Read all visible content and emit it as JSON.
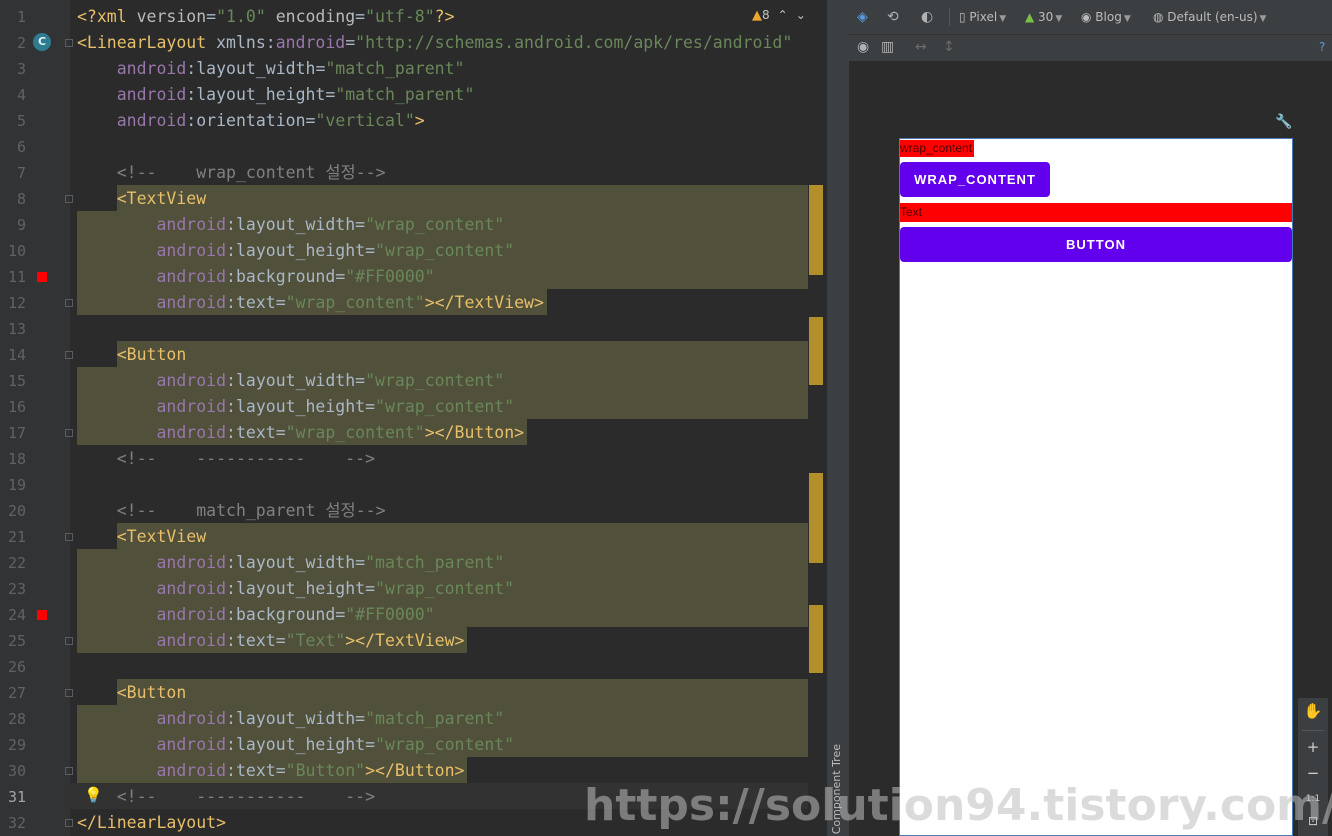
{
  "editor": {
    "line_numbers": [
      "1",
      "2",
      "3",
      "4",
      "5",
      "6",
      "7",
      "8",
      "9",
      "10",
      "11",
      "12",
      "13",
      "14",
      "15",
      "16",
      "17",
      "18",
      "19",
      "20",
      "21",
      "22",
      "23",
      "24",
      "25",
      "26",
      "27",
      "28",
      "29",
      "30",
      "31",
      "32"
    ],
    "warning_count": "8",
    "class_badge": "C",
    "lines": [
      [
        [
          "pi",
          "<?xml "
        ],
        [
          "attr2",
          "version"
        ],
        [
          "eq",
          "="
        ],
        [
          "val",
          "\"1.0\""
        ],
        [
          "attr2",
          " encoding"
        ],
        [
          "eq",
          "="
        ],
        [
          "val",
          "\"utf-8\""
        ],
        [
          "pi",
          "?>"
        ]
      ],
      [
        [
          "tag",
          "<LinearLayout "
        ],
        [
          "plain",
          "xmlns:"
        ],
        [
          "attr",
          "android"
        ],
        [
          "eq",
          "="
        ],
        [
          "val",
          "\"http://schemas.android.com/apk/res/android\""
        ]
      ],
      [
        [
          "plain",
          "    "
        ],
        [
          "attr",
          "android"
        ],
        [
          "plain",
          ":layout_width"
        ],
        [
          "eq",
          "="
        ],
        [
          "val",
          "\"match_parent\""
        ]
      ],
      [
        [
          "plain",
          "    "
        ],
        [
          "attr",
          "android"
        ],
        [
          "plain",
          ":layout_height"
        ],
        [
          "eq",
          "="
        ],
        [
          "val",
          "\"match_parent\""
        ]
      ],
      [
        [
          "plain",
          "    "
        ],
        [
          "attr",
          "android"
        ],
        [
          "plain",
          ":orientation"
        ],
        [
          "eq",
          "="
        ],
        [
          "val",
          "\"vertical\""
        ],
        [
          "tag",
          ">"
        ]
      ],
      [],
      [
        [
          "com",
          "    <!--    wrap_content 설정-->"
        ]
      ],
      [
        [
          "plain",
          "    "
        ],
        [
          "tag",
          "<TextView"
        ]
      ],
      [
        [
          "plain",
          "        "
        ],
        [
          "attr",
          "android"
        ],
        [
          "plain",
          ":layout_width"
        ],
        [
          "eq",
          "="
        ],
        [
          "val",
          "\"wrap_content\""
        ]
      ],
      [
        [
          "plain",
          "        "
        ],
        [
          "attr",
          "android"
        ],
        [
          "plain",
          ":layout_height"
        ],
        [
          "eq",
          "="
        ],
        [
          "val",
          "\"wrap_content\""
        ]
      ],
      [
        [
          "plain",
          "        "
        ],
        [
          "attr",
          "android"
        ],
        [
          "plain",
          ":background"
        ],
        [
          "eq",
          "="
        ],
        [
          "val",
          "\"#FF0000\""
        ]
      ],
      [
        [
          "plain",
          "        "
        ],
        [
          "attr",
          "android"
        ],
        [
          "plain",
          ":text"
        ],
        [
          "eq",
          "="
        ],
        [
          "val",
          "\"wrap_content\""
        ],
        [
          "tag",
          "></TextView>"
        ]
      ],
      [],
      [
        [
          "plain",
          "    "
        ],
        [
          "tag",
          "<Button"
        ]
      ],
      [
        [
          "plain",
          "        "
        ],
        [
          "attr",
          "android"
        ],
        [
          "plain",
          ":layout_width"
        ],
        [
          "eq",
          "="
        ],
        [
          "val",
          "\"wrap_content\""
        ]
      ],
      [
        [
          "plain",
          "        "
        ],
        [
          "attr",
          "android"
        ],
        [
          "plain",
          ":layout_height"
        ],
        [
          "eq",
          "="
        ],
        [
          "val",
          "\"wrap_content\""
        ]
      ],
      [
        [
          "plain",
          "        "
        ],
        [
          "attr",
          "android"
        ],
        [
          "plain",
          ":text"
        ],
        [
          "eq",
          "="
        ],
        [
          "val",
          "\"wrap_content\""
        ],
        [
          "tag",
          "></Button>"
        ]
      ],
      [
        [
          "com",
          "    <!--    -----------    -->"
        ]
      ],
      [],
      [
        [
          "com",
          "    <!--    match_parent 설정-->"
        ]
      ],
      [
        [
          "plain",
          "    "
        ],
        [
          "tag",
          "<TextView"
        ]
      ],
      [
        [
          "plain",
          "        "
        ],
        [
          "attr",
          "android"
        ],
        [
          "plain",
          ":layout_width"
        ],
        [
          "eq",
          "="
        ],
        [
          "val",
          "\"match_parent\""
        ]
      ],
      [
        [
          "plain",
          "        "
        ],
        [
          "attr",
          "android"
        ],
        [
          "plain",
          ":layout_height"
        ],
        [
          "eq",
          "="
        ],
        [
          "val",
          "\"wrap_content\""
        ]
      ],
      [
        [
          "plain",
          "        "
        ],
        [
          "attr",
          "android"
        ],
        [
          "plain",
          ":background"
        ],
        [
          "eq",
          "="
        ],
        [
          "val",
          "\"#FF0000\""
        ]
      ],
      [
        [
          "plain",
          "        "
        ],
        [
          "attr",
          "android"
        ],
        [
          "plain",
          ":text"
        ],
        [
          "eq",
          "="
        ],
        [
          "val",
          "\"Text\""
        ],
        [
          "tag",
          "></TextView>"
        ]
      ],
      [],
      [
        [
          "plain",
          "    "
        ],
        [
          "tag",
          "<Button"
        ]
      ],
      [
        [
          "plain",
          "        "
        ],
        [
          "attr",
          "android"
        ],
        [
          "plain",
          ":layout_width"
        ],
        [
          "eq",
          "="
        ],
        [
          "val",
          "\"match_parent\""
        ]
      ],
      [
        [
          "plain",
          "        "
        ],
        [
          "attr",
          "android"
        ],
        [
          "plain",
          ":layout_height"
        ],
        [
          "eq",
          "="
        ],
        [
          "val",
          "\"wrap_content\""
        ]
      ],
      [
        [
          "plain",
          "        "
        ],
        [
          "attr",
          "android"
        ],
        [
          "plain",
          ":text"
        ],
        [
          "eq",
          "="
        ],
        [
          "val",
          "\"Button\""
        ],
        [
          "tag",
          "></Button>"
        ]
      ],
      [
        [
          "com",
          "    <!--    -----------    -->"
        ]
      ],
      [
        [
          "tag",
          "</LinearLayout>"
        ]
      ]
    ]
  },
  "toolbar": {
    "device": "Pixel",
    "api": "30",
    "theme": "Blog",
    "locale": "Default (en-us)",
    "help": "?"
  },
  "preview": {
    "textview1": "wrap_content",
    "button1": "WRAP_CONTENT",
    "textview2": "Text",
    "button2": "BUTTON"
  },
  "side_panel": {
    "component_tree_label": "Component Tree"
  },
  "zoom_controls": {
    "zoom_in": "+",
    "zoom_out": "−",
    "actual_size": "1:1"
  },
  "watermark": "https://solution94.tistory.com/",
  "colors": {
    "textview_bg": "#FF0000",
    "button_bg": "#6200EE",
    "highlight": "#51503B",
    "marker": "#B38F2C"
  }
}
